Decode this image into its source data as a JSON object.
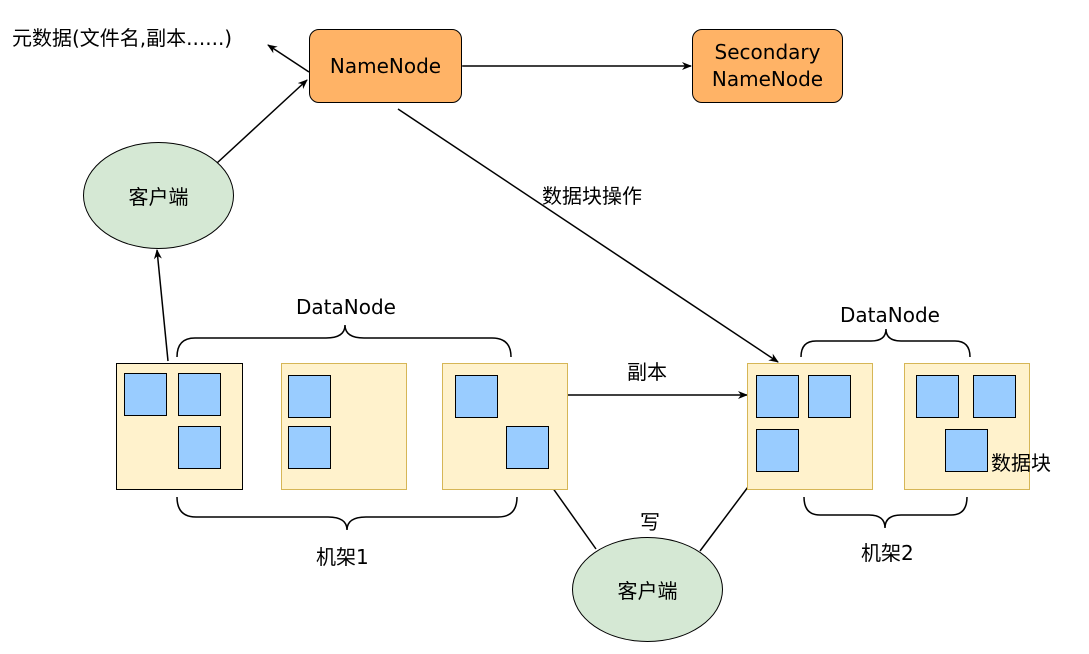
{
  "metadata_note": "元数据(文件名,副本......)",
  "namenode": "NameNode",
  "secondary": {
    "line1": "Secondary",
    "line2": "NameNode"
  },
  "client_top": "客户端",
  "client_bottom": "客户端",
  "block_ops": "数据块操作",
  "datanode_left": "DataNode",
  "datanode_right": "DataNode",
  "replica": "副本",
  "write": "写",
  "rack1": "机架1",
  "rack2": "机架2",
  "data_block": "数据块"
}
